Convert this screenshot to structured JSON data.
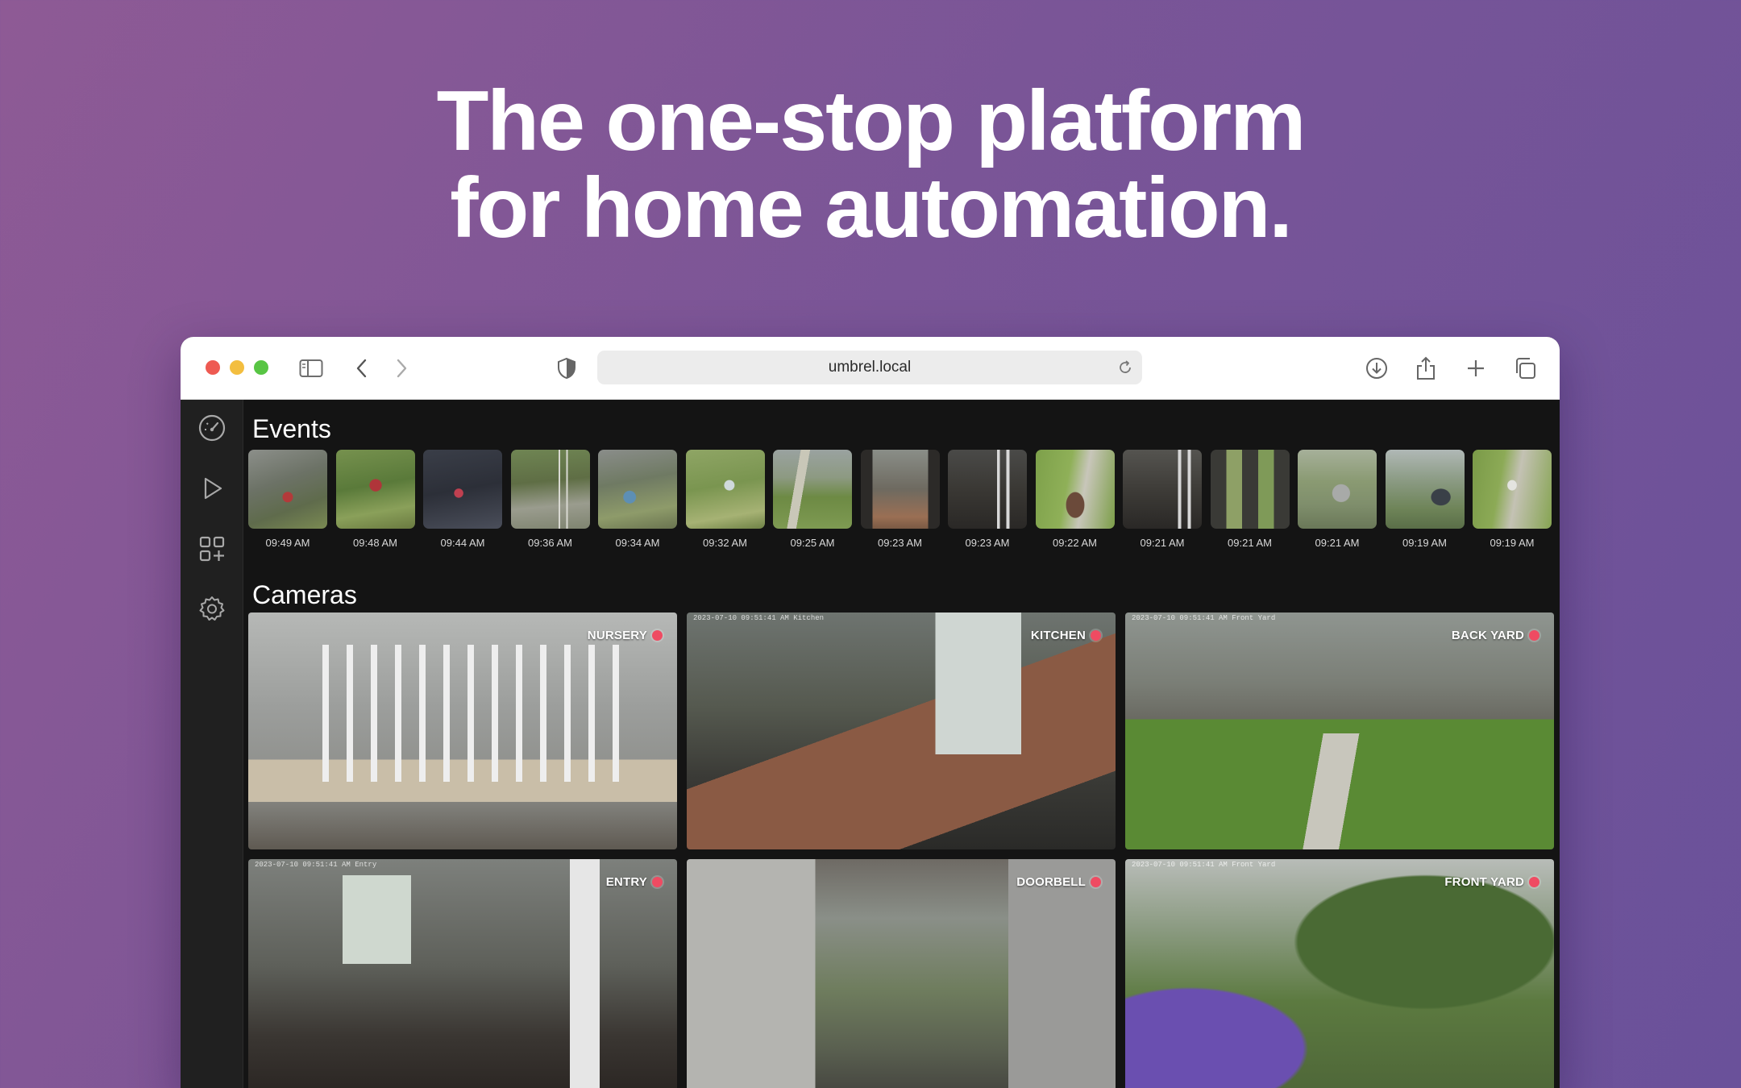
{
  "headline": {
    "line1": "The one-stop platform",
    "line2": "for home automation."
  },
  "browser": {
    "url": "umbrel.local",
    "toolbar_icons": [
      "sidebar-icon",
      "back-icon",
      "forward-icon",
      "shield-icon",
      "download-icon",
      "share-icon",
      "new-tab-icon",
      "tabs-overview-icon"
    ]
  },
  "sidebar": {
    "items": [
      {
        "icon": "dashboard-gauge-icon"
      },
      {
        "icon": "play-icon"
      },
      {
        "icon": "apps-add-icon"
      },
      {
        "icon": "settings-gear-icon"
      }
    ]
  },
  "events": {
    "title": "Events",
    "items": [
      {
        "time": "09:49 AM"
      },
      {
        "time": "09:48 AM"
      },
      {
        "time": "09:44 AM"
      },
      {
        "time": "09:36 AM"
      },
      {
        "time": "09:34 AM"
      },
      {
        "time": "09:32 AM"
      },
      {
        "time": "09:25 AM"
      },
      {
        "time": "09:23 AM"
      },
      {
        "time": "09:23 AM"
      },
      {
        "time": "09:22 AM"
      },
      {
        "time": "09:21 AM"
      },
      {
        "time": "09:21 AM"
      },
      {
        "time": "09:21 AM"
      },
      {
        "time": "09:19 AM"
      },
      {
        "time": "09:19 AM"
      }
    ]
  },
  "cameras": {
    "title": "Cameras",
    "items": [
      {
        "label": "NURSERY",
        "stamp": ""
      },
      {
        "label": "KITCHEN",
        "stamp": "2023-07-10 09:51:41 AM Kitchen"
      },
      {
        "label": "BACK YARD",
        "stamp": "2023-07-10 09:51:41 AM Front Yard"
      },
      {
        "label": "ENTRY",
        "stamp": "2023-07-10 09:51:41 AM Entry"
      },
      {
        "label": "DOORBELL",
        "stamp": ""
      },
      {
        "label": "FRONT YARD",
        "stamp": "2023-07-10 09:51:41 AM Front Yard"
      }
    ]
  },
  "colors": {
    "recording_dot": "#ef4b62",
    "app_background": "#141414",
    "sidebar": "#202020"
  }
}
